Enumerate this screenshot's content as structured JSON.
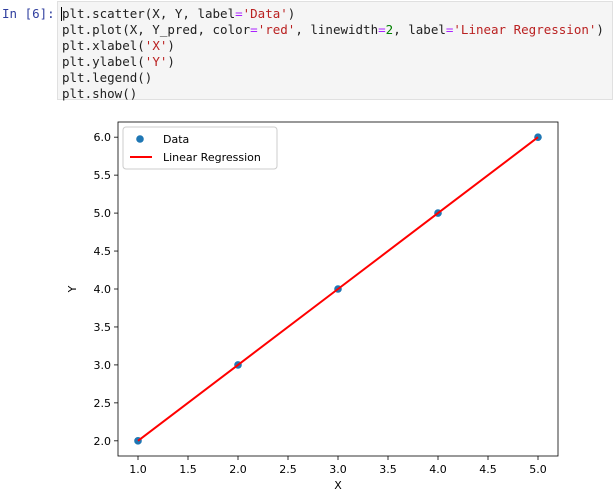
{
  "cell": {
    "prompt": "In [6]:",
    "code_lines": [
      [
        {
          "t": "plt.scatter(X, Y, label"
        },
        {
          "t": "=",
          "c": "op"
        },
        {
          "t": "'Data'",
          "c": "str"
        },
        {
          "t": ")"
        }
      ],
      [
        {
          "t": "plt.plot(X, Y_pred, color"
        },
        {
          "t": "=",
          "c": "op"
        },
        {
          "t": "'red'",
          "c": "str"
        },
        {
          "t": ", linewidth"
        },
        {
          "t": "=",
          "c": "op"
        },
        {
          "t": "2",
          "c": "num"
        },
        {
          "t": ", label"
        },
        {
          "t": "=",
          "c": "op"
        },
        {
          "t": "'Linear Regression'",
          "c": "str"
        },
        {
          "t": ")"
        }
      ],
      [
        {
          "t": "plt.xlabel("
        },
        {
          "t": "'X'",
          "c": "str"
        },
        {
          "t": ")"
        }
      ],
      [
        {
          "t": "plt.ylabel("
        },
        {
          "t": "'Y'",
          "c": "str"
        },
        {
          "t": ")"
        }
      ],
      [
        {
          "t": "plt.legend()"
        }
      ],
      [
        {
          "t": "plt.show()"
        }
      ]
    ]
  },
  "colors": {
    "prompt": "#303f9f",
    "scatter": "#1f77b4",
    "line": "#ff0000"
  },
  "chart_data": {
    "type": "scatter",
    "title": "",
    "xlabel": "X",
    "ylabel": "Y",
    "xlim": [
      0.8,
      5.2
    ],
    "ylim": [
      1.8,
      6.2
    ],
    "x_ticks": [
      1.0,
      1.5,
      2.0,
      2.5,
      3.0,
      3.5,
      4.0,
      4.5,
      5.0
    ],
    "y_ticks": [
      2.0,
      2.5,
      3.0,
      3.5,
      4.0,
      4.5,
      5.0,
      5.5,
      6.0
    ],
    "grid": false,
    "legend_position": "top-left",
    "series": [
      {
        "name": "Data",
        "kind": "scatter",
        "x": [
          1,
          2,
          3,
          4,
          5
        ],
        "y": [
          2,
          3,
          4,
          5,
          6
        ]
      },
      {
        "name": "Linear Regression",
        "kind": "line",
        "x": [
          1,
          2,
          3,
          4,
          5
        ],
        "y": [
          2,
          3,
          4,
          5,
          6
        ]
      }
    ]
  }
}
